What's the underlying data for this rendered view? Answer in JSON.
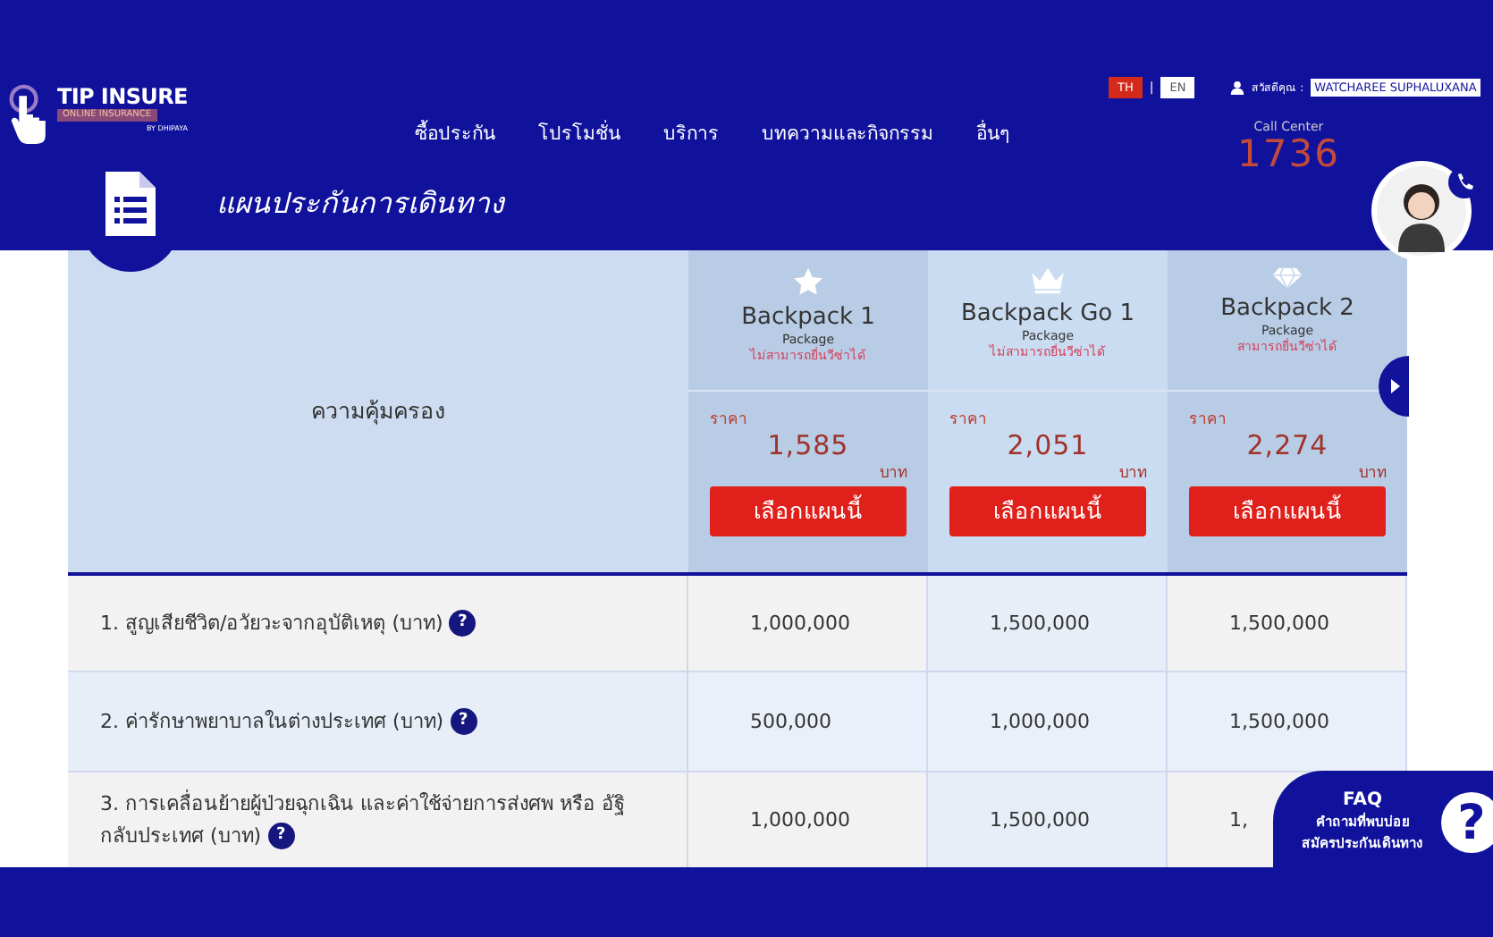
{
  "header": {
    "logo": {
      "name": "TIP INSURE",
      "tagline": "ONLINE INSURANCE",
      "byline": "BY DHIPAYA"
    },
    "nav": [
      "ซื้อประกัน",
      "โปรโมชั่น",
      "บริการ",
      "บทความและกิจกรรม",
      "อื่นๆ"
    ],
    "languages": [
      {
        "label": "TH",
        "selected": true
      },
      {
        "label": "EN",
        "selected": false
      }
    ],
    "language_separator": "|",
    "greeting": "สวัสดีคุณ :",
    "user_name": "WATCHAREE SUPHALUXANA",
    "call_center": {
      "label": "Call Center",
      "number": "1736"
    }
  },
  "page_title": "แผนประกันการเดินทาง",
  "table": {
    "coverage_heading": "ความคุ้มครอง",
    "packages": [
      {
        "kind": "star",
        "name": "Backpack 1",
        "sub": "Package",
        "note": "ไม่สามารถยื่นวีซ่าได้",
        "price_label": "ราคา",
        "price": "1,585",
        "currency": "บาท",
        "button": "เลือกแผนนี้"
      },
      {
        "kind": "crown",
        "name": "Backpack Go 1",
        "sub": "Package",
        "note": "ไม่สามารถยื่นวีซ่าได้",
        "price_label": "ราคา",
        "price": "2,051",
        "currency": "บาท",
        "button": "เลือกแผนนี้"
      },
      {
        "kind": "diamond",
        "name": "Backpack 2",
        "sub": "Package",
        "note": "สามารถยื่นวีซ่าได้",
        "price_label": "ราคา",
        "price": "2,274",
        "currency": "บาท",
        "button": "เลือกแผนนี้"
      }
    ],
    "rows": [
      {
        "label": "1. สูญเสียชีวิต/อวัยวะจากอุบัติเหตุ (บาท)",
        "help": "?",
        "values": [
          "1,000,000",
          "1,500,000",
          "1,500,000"
        ]
      },
      {
        "label": "2. ค่ารักษาพยาบาลในต่างประเทศ (บาท)",
        "help": "?",
        "values": [
          "500,000",
          "1,000,000",
          "1,500,000"
        ]
      },
      {
        "label": "3. การเคลื่อนย้ายผู้ป่วยฉุกเฉิน และค่าใช้จ่ายการส่งศพ หรือ อัฐิกลับประเทศ (บาท)",
        "help": "?",
        "values": [
          "1,000,000",
          "1,500,000",
          "1,"
        ]
      }
    ]
  },
  "faq": {
    "title": "FAQ",
    "line1": "คำถามที่พบบ่อย",
    "line2": "สมัครประกันเดินทาง",
    "mark": "?"
  }
}
